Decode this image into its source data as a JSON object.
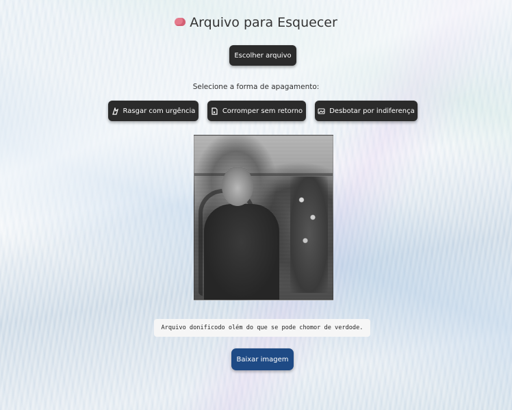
{
  "header": {
    "icon": "brain-icon",
    "title": "Arquivo para Esquecer"
  },
  "upload": {
    "choose_label": "Escolher arquivo"
  },
  "erase": {
    "prompt": "Selecione a forma de apagamento:",
    "options": [
      {
        "label": "Rasgar com urgência",
        "icon": "tear-icon"
      },
      {
        "label": "Corromper sem retorno",
        "icon": "corrupt-file-icon"
      },
      {
        "label": "Desbotar por indiferença",
        "icon": "fade-icon"
      }
    ]
  },
  "result": {
    "caption": "Arquivo donificodo olém do que se pode chomor de verdode.",
    "download_label": "Baixar imagem"
  },
  "colors": {
    "button_dark": "#2b2b2b",
    "button_primary": "#1e4a85",
    "caption_bg": "#f6f6f6"
  }
}
